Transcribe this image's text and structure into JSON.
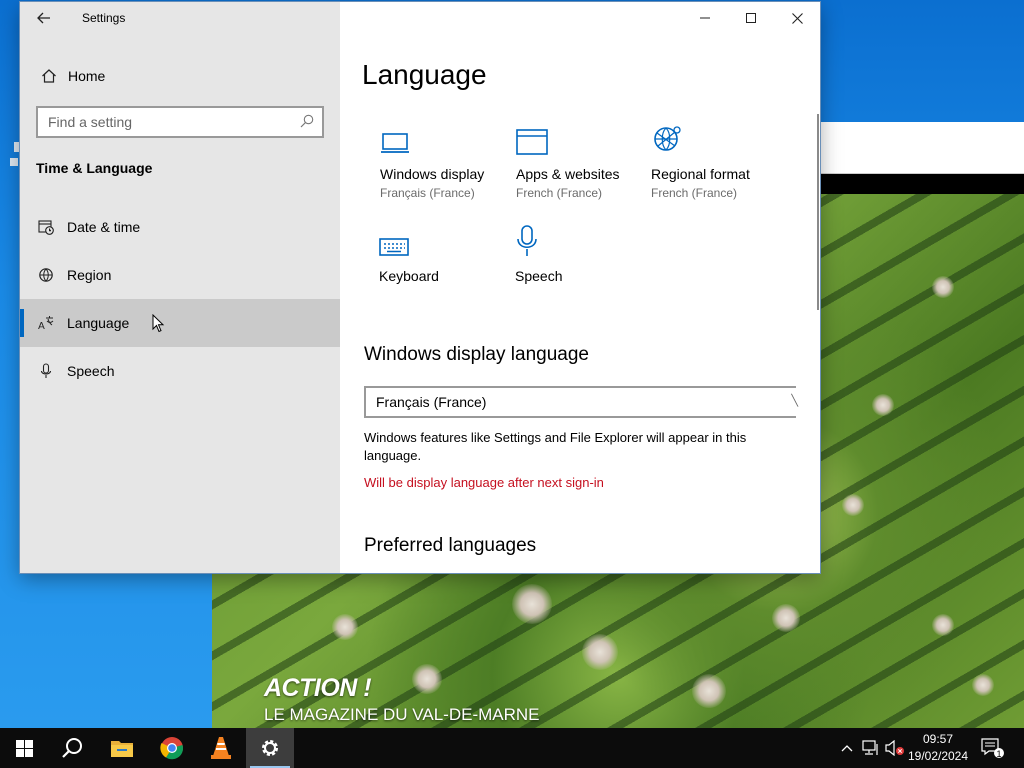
{
  "window": {
    "title": "Settings"
  },
  "sidebar": {
    "home_label": "Home",
    "search_placeholder": "Find a setting",
    "section_title": "Time & Language",
    "items": [
      {
        "label": "Date & time",
        "icon": "date-time-icon"
      },
      {
        "label": "Region",
        "icon": "region-globe-icon"
      },
      {
        "label": "Language",
        "icon": "language-icon",
        "selected": true
      },
      {
        "label": "Speech",
        "icon": "microphone-icon"
      }
    ]
  },
  "main": {
    "title": "Language",
    "tiles": [
      {
        "label": "Windows display",
        "sub": "Français (France)",
        "icon": "monitor-icon"
      },
      {
        "label": "Apps & websites",
        "sub": "French (France)",
        "icon": "app-window-icon"
      },
      {
        "label": "Regional format",
        "sub": "French (France)",
        "icon": "regional-globe-icon"
      },
      {
        "label": "Keyboard",
        "sub": "",
        "icon": "keyboard-icon"
      },
      {
        "label": "Speech",
        "sub": "",
        "icon": "microphone-icon"
      }
    ],
    "display_language": {
      "heading": "Windows display language",
      "selected": "Français (France)",
      "description": "Windows features like Settings and File Explorer will appear in this language.",
      "warning": "Will be display language after next sign-in"
    },
    "preferred_heading": "Preferred languages"
  },
  "background_video": {
    "brand_title": "ACTION !",
    "brand_subtitle": "LE MAGAZINE  DU VAL-DE-MARNE"
  },
  "taskbar": {
    "apps": [
      "start-icon",
      "search-icon",
      "file-explorer-icon",
      "chrome-icon",
      "vlc-icon",
      "settings-gear-icon"
    ],
    "time": "09:57",
    "date": "19/02/2024",
    "notification_count": "1"
  },
  "colors": {
    "accent": "#0067c0",
    "warning": "#c50f1f",
    "sidebar_bg": "#e6e6e6"
  }
}
